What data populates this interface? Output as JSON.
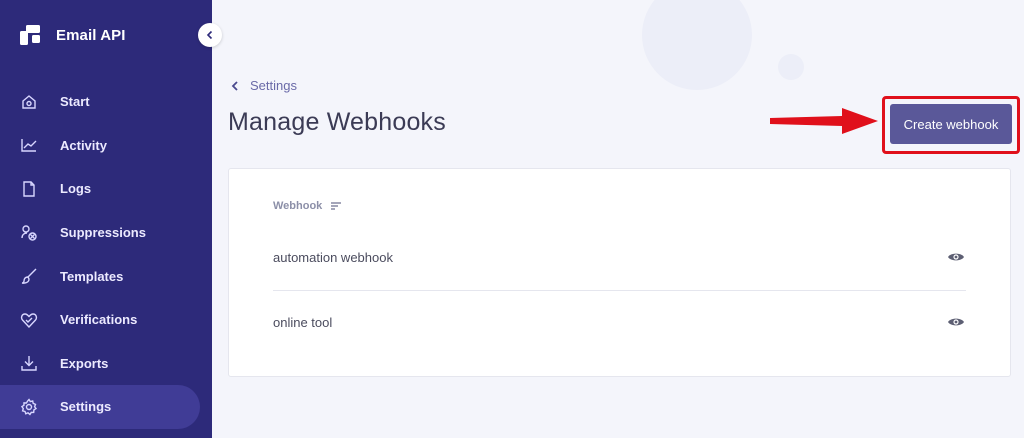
{
  "app": {
    "name": "Email API"
  },
  "sidebar": {
    "items": [
      {
        "label": "Start",
        "icon": "home-icon"
      },
      {
        "label": "Activity",
        "icon": "activity-chart-icon"
      },
      {
        "label": "Logs",
        "icon": "document-icon"
      },
      {
        "label": "Suppressions",
        "icon": "suppression-icon"
      },
      {
        "label": "Templates",
        "icon": "brush-icon"
      },
      {
        "label": "Verifications",
        "icon": "heart-check-icon"
      },
      {
        "label": "Exports",
        "icon": "download-icon"
      },
      {
        "label": "Settings",
        "icon": "gear-icon",
        "active": true
      }
    ]
  },
  "breadcrumb": {
    "label": "Settings"
  },
  "page": {
    "title": "Manage Webhooks",
    "create_button": "Create webhook"
  },
  "table": {
    "column_header": "Webhook",
    "rows": [
      {
        "name": "automation webhook"
      },
      {
        "name": "online tool"
      }
    ]
  },
  "colors": {
    "sidebar_bg": "#2d2a7a",
    "sidebar_active": "#403c96",
    "button_bg": "#5a5899",
    "annotation_red": "#e0101b"
  }
}
